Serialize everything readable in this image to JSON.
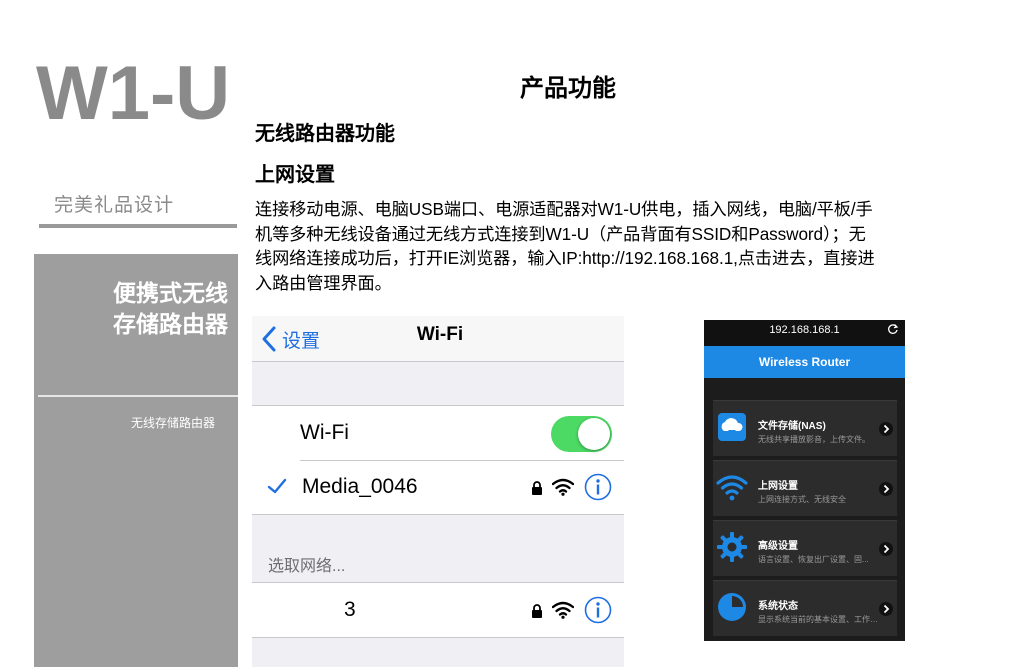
{
  "brand": "W1-U",
  "subtitle": "完美礼品设计",
  "sidebar": {
    "title_line1": "便携式无线",
    "title_line2": "存储路由器",
    "subtitle": "无线存储路由器"
  },
  "main": {
    "title": "产品功能",
    "section_title": "无线路由器功能",
    "sub_title": "上网设置",
    "body_line1": "连接移动电源、电脑USB端口、电源适配器对W1-U供电，插入网线，电脑/平板/手",
    "body_line2": "机等多种无线设备通过无线方式连接到W1-U（产品背面有SSID和Password）；无",
    "body_line3": "线网络连接成功后，打开IE浏览器，输入IP:http://192.168.168.1,点击进去，直接进",
    "body_line4": "入路由管理界面。"
  },
  "ios_wifi": {
    "back_label": "设置",
    "nav_title": "Wi-Fi",
    "wifi_label": "Wi-Fi",
    "wifi_on": true,
    "connected_network": "Media_0046",
    "choose_network_label": "选取网络...",
    "networks": [
      "3"
    ],
    "colors": {
      "accent": "#1f6fe0",
      "toggle_on": "#4cd964"
    }
  },
  "router_app": {
    "address": "192.168.168.1",
    "header_title": "Wireless Router",
    "header_color": "#1e88e5",
    "menu": [
      {
        "title": "文件存储(NAS)",
        "desc": "无线共享播放影音，上传文件。",
        "icon": "cloud-storage-icon"
      },
      {
        "title": "上网设置",
        "desc": "上网连接方式、无线安全",
        "icon": "wifi-icon"
      },
      {
        "title": "高级设置",
        "desc": "语言设置、恢复出厂设置、固...",
        "icon": "gear-icon"
      },
      {
        "title": "系统状态",
        "desc": "显示系统当前的基本设置、工作状...",
        "icon": "pie-chart-icon"
      }
    ]
  }
}
